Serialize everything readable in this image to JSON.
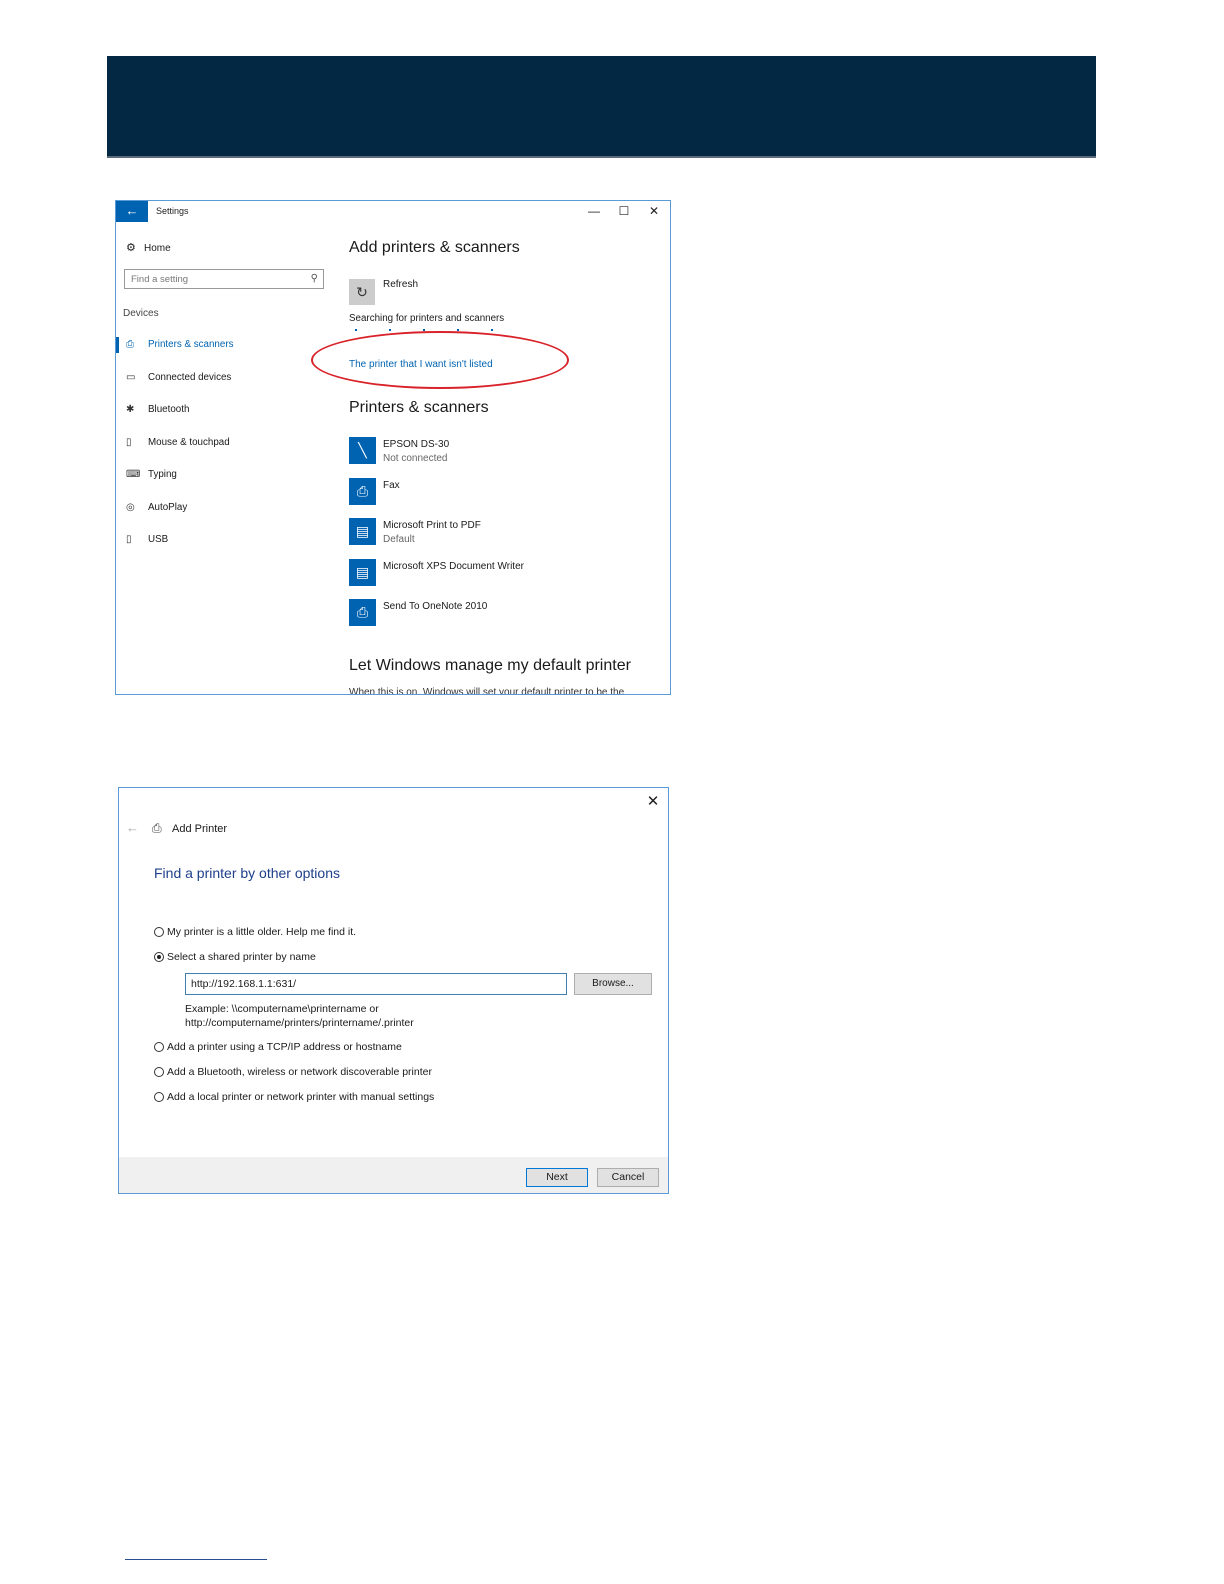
{
  "settings_window": {
    "title": "Settings",
    "controls": {
      "minimize": "—",
      "maximize": "☐",
      "close": "✕"
    },
    "nav": {
      "home": "Home",
      "search_placeholder": "Find a setting",
      "section": "Devices",
      "items": [
        {
          "label": "Printers & scanners",
          "icon": "printer-icon",
          "active": true
        },
        {
          "label": "Connected devices",
          "icon": "devices-icon",
          "active": false
        },
        {
          "label": "Bluetooth",
          "icon": "bluetooth-icon",
          "active": false
        },
        {
          "label": "Mouse & touchpad",
          "icon": "mouse-icon",
          "active": false
        },
        {
          "label": "Typing",
          "icon": "keyboard-icon",
          "active": false
        },
        {
          "label": "AutoPlay",
          "icon": "autoplay-icon",
          "active": false
        },
        {
          "label": "USB",
          "icon": "usb-icon",
          "active": false
        }
      ]
    },
    "main": {
      "add_heading": "Add printers & scanners",
      "refresh_label": "Refresh",
      "searching_text": "Searching for printers and scanners",
      "not_listed_link": "The printer that I want isn't listed",
      "printers_heading": "Printers & scanners",
      "devices": [
        {
          "name": "EPSON DS-30",
          "status": "Not connected",
          "icon": "scanner-icon"
        },
        {
          "name": "Fax",
          "status": "",
          "icon": "fax-icon"
        },
        {
          "name": "Microsoft Print to PDF",
          "status": "Default",
          "icon": "pdf-printer-icon"
        },
        {
          "name": "Microsoft XPS Document Writer",
          "status": "",
          "icon": "xps-printer-icon"
        },
        {
          "name": "Send To OneNote 2010",
          "status": "",
          "icon": "onenote-printer-icon"
        }
      ],
      "default_heading": "Let Windows manage my default printer",
      "cut_off_text": "When this is on, Windows will set your default printer to be the"
    },
    "colors": {
      "accent": "#0063b1",
      "highlight_ellipse": "#d9232a"
    }
  },
  "add_printer_dialog": {
    "title": "Add Printer",
    "heading": "Find a printer by other options",
    "options": [
      {
        "label": "My printer is a little older. Help me find it.",
        "selected": false
      },
      {
        "label": "Select a shared printer by name",
        "selected": true
      },
      {
        "label": "Add a printer using a TCP/IP address or hostname",
        "selected": false
      },
      {
        "label": "Add a Bluetooth, wireless or network discoverable printer",
        "selected": false
      },
      {
        "label": "Add a local printer or network printer with manual settings",
        "selected": false
      }
    ],
    "address_value": "http://192.168.1.1:631/",
    "browse_label": "Browse...",
    "example_line1": "Example: \\\\computername\\printername or",
    "example_line2": "http://computername/printers/printername/.printer",
    "next_label": "Next",
    "cancel_label": "Cancel"
  },
  "banner_color": "#022843"
}
